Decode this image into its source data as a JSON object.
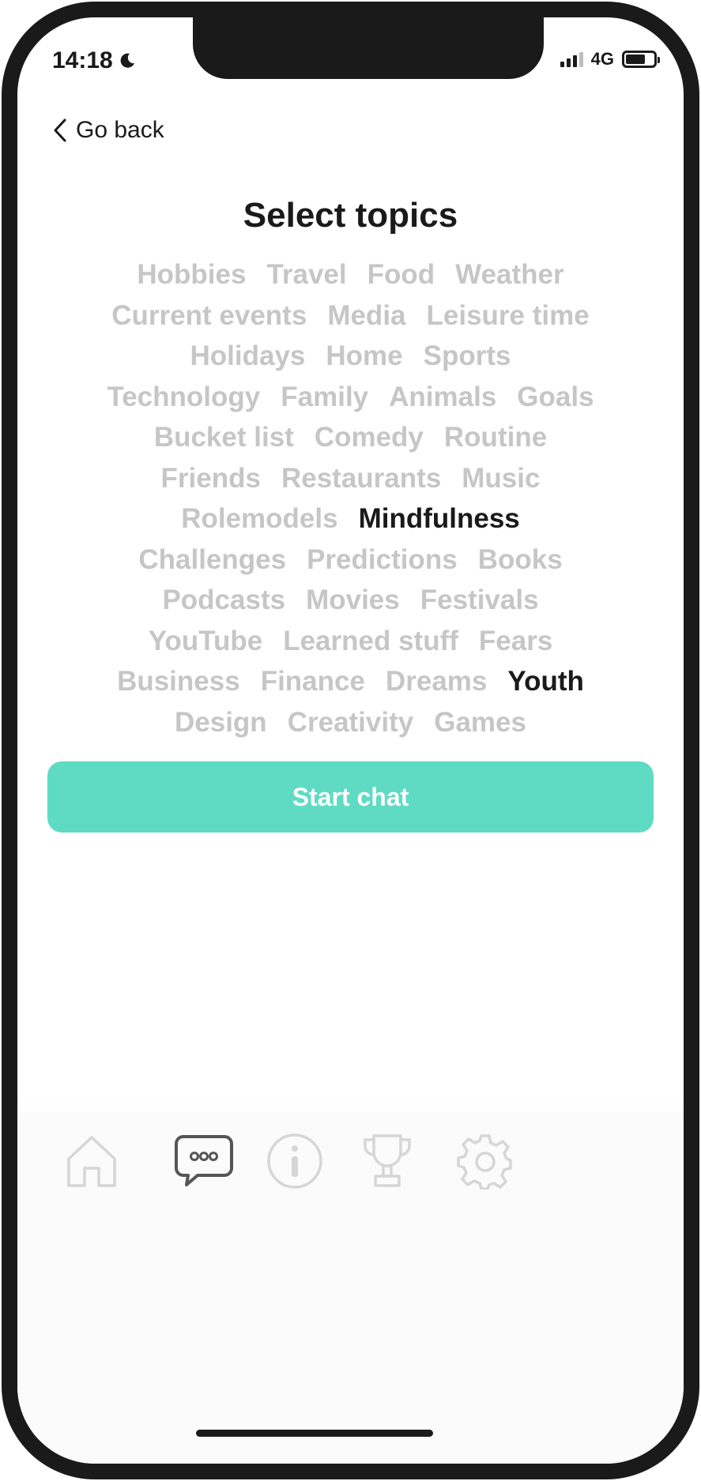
{
  "status_bar": {
    "time": "14:18",
    "network": "4G",
    "icons": [
      "moon-icon",
      "signal-icon",
      "battery-icon"
    ]
  },
  "nav": {
    "back_label": "Go back"
  },
  "page": {
    "title": "Select topics"
  },
  "topic_lines": [
    [
      {
        "label": "Hobbies",
        "selected": false
      },
      {
        "label": "Travel",
        "selected": false
      },
      {
        "label": "Food",
        "selected": false
      },
      {
        "label": "Weather",
        "selected": false
      }
    ],
    [
      {
        "label": "Current events",
        "selected": false
      },
      {
        "label": "Media",
        "selected": false
      },
      {
        "label": "Leisure time",
        "selected": false
      }
    ],
    [
      {
        "label": "Holidays",
        "selected": false
      },
      {
        "label": "Home",
        "selected": false
      },
      {
        "label": "Sports",
        "selected": false
      }
    ],
    [
      {
        "label": "Technology",
        "selected": false
      },
      {
        "label": "Family",
        "selected": false
      },
      {
        "label": "Animals",
        "selected": false
      },
      {
        "label": "Goals",
        "selected": false
      }
    ],
    [
      {
        "label": "Bucket list",
        "selected": false
      },
      {
        "label": "Comedy",
        "selected": false
      },
      {
        "label": "Routine",
        "selected": false
      }
    ],
    [
      {
        "label": "Friends",
        "selected": false
      },
      {
        "label": "Restaurants",
        "selected": false
      },
      {
        "label": "Music",
        "selected": false
      }
    ],
    [
      {
        "label": "Rolemodels",
        "selected": false
      },
      {
        "label": "Mindfulness",
        "selected": true
      }
    ],
    [
      {
        "label": "Challenges",
        "selected": false
      },
      {
        "label": "Predictions",
        "selected": false
      },
      {
        "label": "Books",
        "selected": false
      }
    ],
    [
      {
        "label": "Podcasts",
        "selected": false
      },
      {
        "label": "Movies",
        "selected": false
      },
      {
        "label": "Festivals",
        "selected": false
      }
    ],
    [
      {
        "label": "YouTube",
        "selected": false
      },
      {
        "label": "Learned stuff",
        "selected": false
      },
      {
        "label": "Fears",
        "selected": false
      }
    ],
    [
      {
        "label": "Business",
        "selected": false
      },
      {
        "label": "Finance",
        "selected": false
      },
      {
        "label": "Dreams",
        "selected": false
      },
      {
        "label": "Youth",
        "selected": true
      }
    ],
    [
      {
        "label": "Design",
        "selected": false
      },
      {
        "label": "Creativity",
        "selected": false
      },
      {
        "label": "Games",
        "selected": false
      }
    ]
  ],
  "actions": {
    "start_chat_label": "Start chat"
  },
  "tab_bar": {
    "tabs": [
      {
        "icon": "home-icon",
        "active": false
      },
      {
        "icon": "chat-icon",
        "active": true
      },
      {
        "icon": "info-icon",
        "active": false
      },
      {
        "icon": "trophy-icon",
        "active": false
      },
      {
        "icon": "gear-icon",
        "active": false
      }
    ]
  },
  "colors": {
    "accent": "#5fdbc4",
    "topic_inactive": "#c6c6c6",
    "topic_selected": "#1a1a1a",
    "tab_inactive": "#d6d6d6",
    "tab_active": "#555555"
  }
}
